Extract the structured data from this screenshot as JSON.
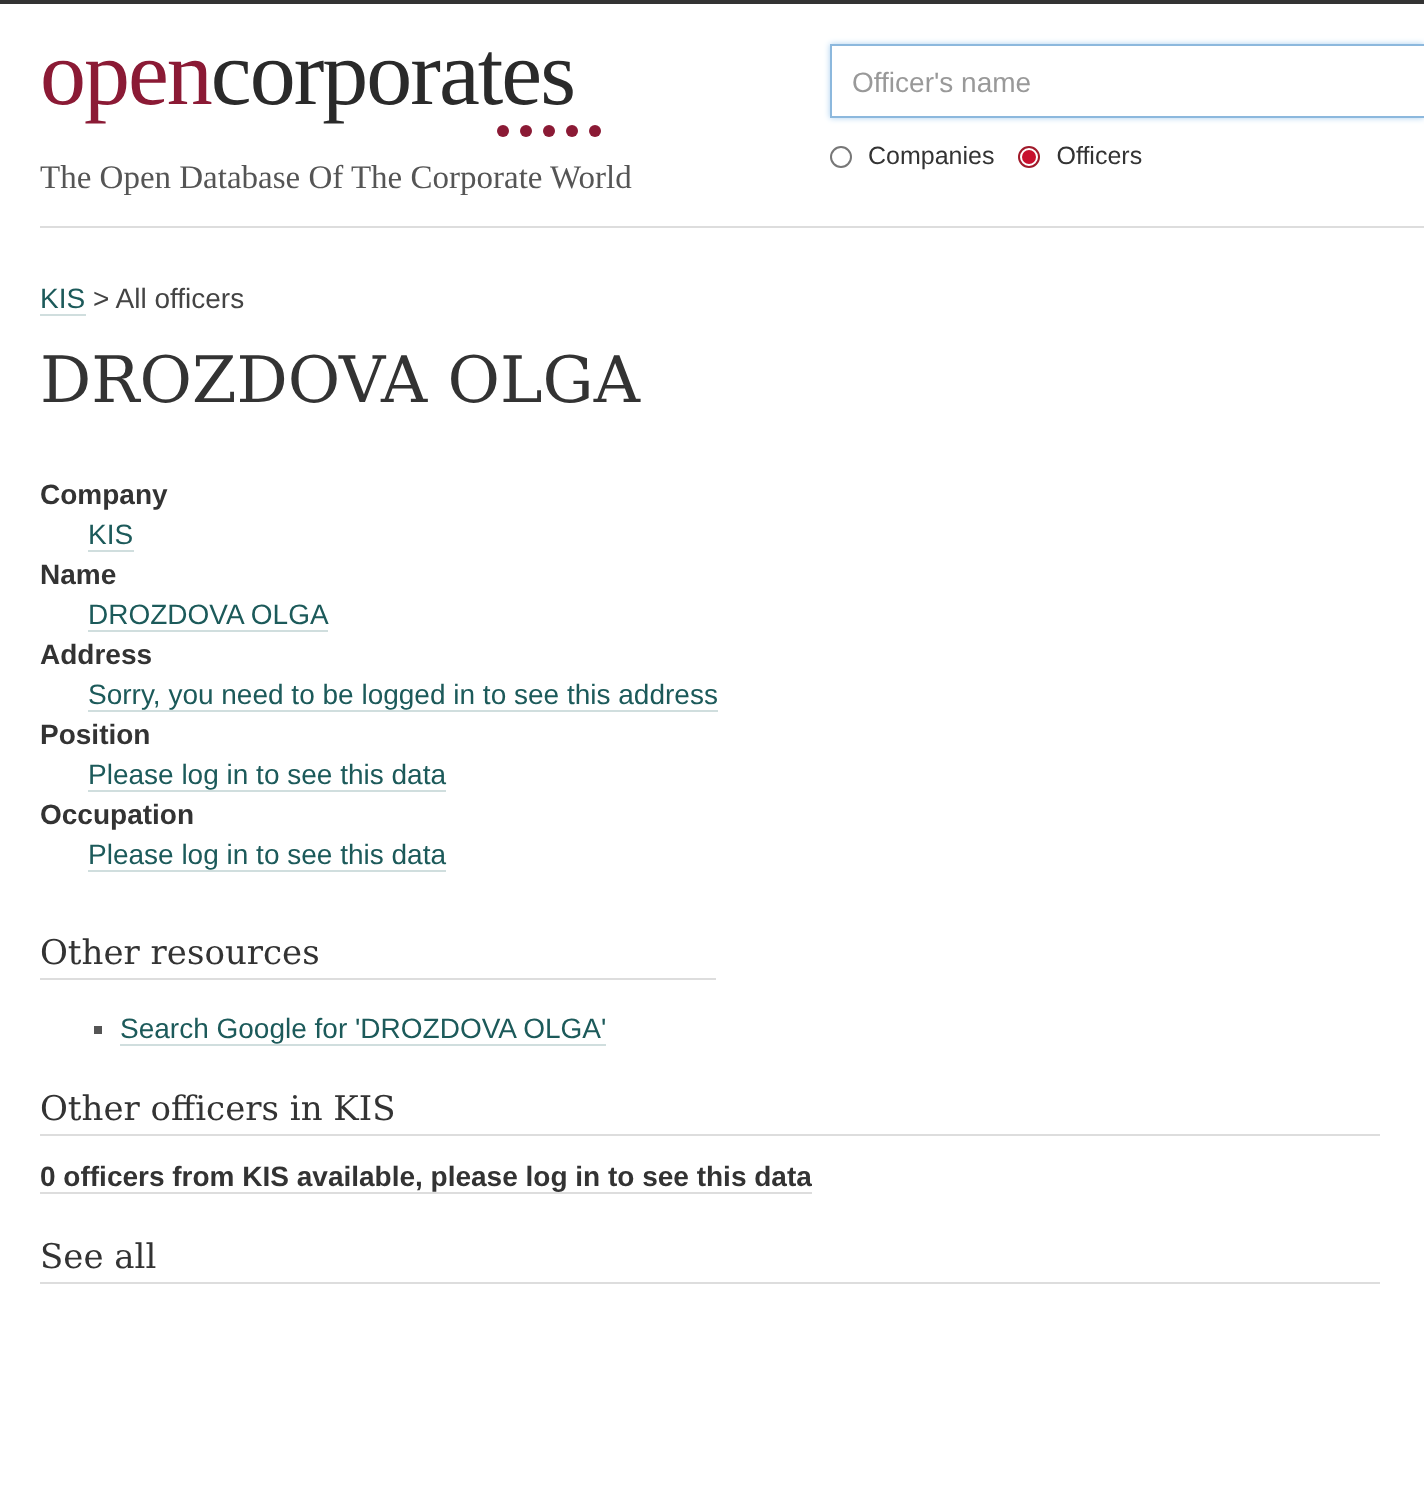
{
  "header": {
    "logo": [
      {
        "kind": "accent",
        "text": "open"
      },
      {
        "kind": "plain",
        "text": "corporates"
      }
    ],
    "tagline": "The Open Database Of The Corporate World",
    "search": {
      "placeholder": "Officer's name"
    },
    "search_types": [
      {
        "label": "Companies",
        "selected": false
      },
      {
        "label": "Officers",
        "selected": true
      }
    ]
  },
  "breadcrumb": {
    "link": "KIS",
    "separator": ">",
    "current": "All officers"
  },
  "title": "DROZDOVA OLGA",
  "attributes": [
    {
      "label": "Company",
      "value": "KIS"
    },
    {
      "label": "Name",
      "value": "DROZDOVA OLGA"
    },
    {
      "label": "Address",
      "value": "Sorry, you need to be logged in to see this address"
    },
    {
      "label": "Position",
      "value": "Please log in to see this data"
    },
    {
      "label": "Occupation",
      "value": "Please log in to see this data"
    }
  ],
  "sections": [
    {
      "kind": "links",
      "heading": "Other resources",
      "items": [
        "Search Google for 'DROZDOVA OLGA'"
      ]
    },
    {
      "kind": "notice",
      "heading": "Other officers in KIS",
      "text": "0 officers from KIS available, please log in to see this data"
    },
    {
      "kind": "heading",
      "heading": "See all"
    }
  ]
}
